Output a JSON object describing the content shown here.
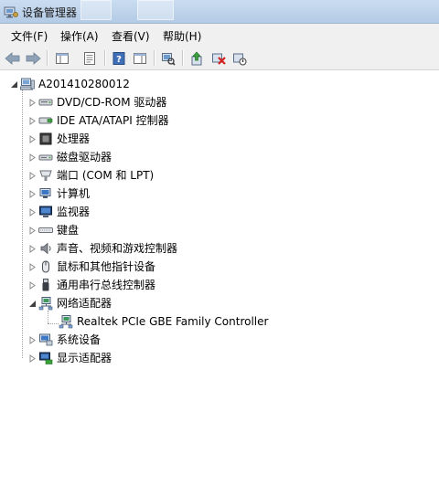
{
  "window": {
    "title": "设备管理器"
  },
  "menu": [
    {
      "label": "文件(F)"
    },
    {
      "label": "操作(A)"
    },
    {
      "label": "查看(V)"
    },
    {
      "label": "帮助(H)"
    }
  ],
  "toolbar": [
    {
      "icon": "back-arrow-icon"
    },
    {
      "icon": "forward-arrow-icon"
    },
    {
      "icon": "console-tree-icon"
    },
    {
      "icon": "properties-icon"
    },
    {
      "icon": "help-icon"
    },
    {
      "icon": "action-pane-icon"
    },
    {
      "icon": "scan-hardware-icon"
    },
    {
      "icon": "update-driver-icon"
    },
    {
      "icon": "uninstall-icon"
    },
    {
      "icon": "disable-device-icon"
    }
  ],
  "tree": {
    "root": {
      "label": "A201410280012",
      "icon": "computer-icon"
    },
    "categories": [
      {
        "label": "DVD/CD-ROM 驱动器",
        "icon": "dvd-drive-icon",
        "expanded": false
      },
      {
        "label": "IDE ATA/ATAPI 控制器",
        "icon": "ide-controller-icon",
        "expanded": false
      },
      {
        "label": "处理器",
        "icon": "processor-icon",
        "expanded": false
      },
      {
        "label": "磁盘驱动器",
        "icon": "disk-drive-icon",
        "expanded": false
      },
      {
        "label": "端口 (COM 和 LPT)",
        "icon": "port-icon",
        "expanded": false
      },
      {
        "label": "计算机",
        "icon": "computer-category-icon",
        "expanded": false
      },
      {
        "label": "监视器",
        "icon": "monitor-icon",
        "expanded": false
      },
      {
        "label": "键盘",
        "icon": "keyboard-icon",
        "expanded": false
      },
      {
        "label": "声音、视频和游戏控制器",
        "icon": "sound-icon",
        "expanded": false
      },
      {
        "label": "鼠标和其他指针设备",
        "icon": "mouse-icon",
        "expanded": false
      },
      {
        "label": "通用串行总线控制器",
        "icon": "usb-icon",
        "expanded": false
      },
      {
        "label": "网络适配器",
        "icon": "network-adapter-icon",
        "expanded": true,
        "children": [
          {
            "label": "Realtek PCIe GBE Family Controller",
            "icon": "network-card-icon"
          }
        ]
      },
      {
        "label": "系统设备",
        "icon": "system-device-icon",
        "expanded": false
      },
      {
        "label": "显示适配器",
        "icon": "display-adapter-icon",
        "expanded": false
      }
    ]
  }
}
